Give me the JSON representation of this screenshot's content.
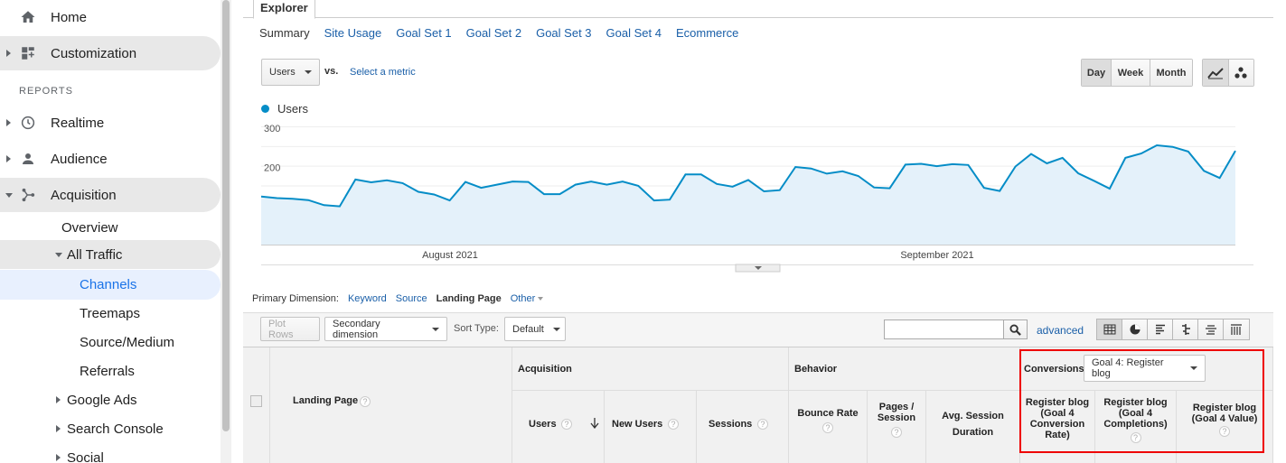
{
  "sidebar": {
    "home": "Home",
    "customization": "Customization",
    "section": "REPORTS",
    "realtime": "Realtime",
    "audience": "Audience",
    "acquisition": "Acquisition",
    "overview": "Overview",
    "all_traffic": "All Traffic",
    "channels": "Channels",
    "treemaps": "Treemaps",
    "source_medium": "Source/Medium",
    "referrals": "Referrals",
    "google_ads": "Google Ads",
    "search_console": "Search Console",
    "social": "Social"
  },
  "explorer": {
    "tab": "Explorer",
    "subtabs": [
      "Summary",
      "Site Usage",
      "Goal Set 1",
      "Goal Set 2",
      "Goal Set 3",
      "Goal Set 4",
      "Ecommerce"
    ]
  },
  "controls": {
    "metric": "Users",
    "vs": "vs.",
    "select_metric": "Select a metric",
    "day": "Day",
    "week": "Week",
    "month": "Month"
  },
  "chart_data": {
    "type": "area",
    "series": [
      {
        "name": "Users",
        "color": "#058dc7",
        "values": [
          122,
          118,
          116,
          113,
          100,
          97,
          165,
          158,
          163,
          156,
          134,
          127,
          112,
          159,
          144,
          152,
          160,
          159,
          128,
          128,
          152,
          160,
          152,
          160,
          149,
          112,
          114,
          178,
          178,
          154,
          147,
          164,
          135,
          138,
          197,
          193,
          180,
          186,
          174,
          145,
          143,
          203,
          205,
          199,
          204,
          202,
          144,
          136,
          198,
          230,
          206,
          220,
          181,
          162,
          142,
          220,
          231,
          252,
          248,
          236,
          187,
          169,
          238
        ],
        "fill": "#e4f1fa"
      }
    ],
    "x_labels": [
      "August 2021",
      "September 2021"
    ],
    "y_ticks": [
      100,
      200,
      300
    ],
    "ylim": [
      0,
      300
    ]
  },
  "table": {
    "primary_dimension_label": "Primary Dimension:",
    "dimensions": [
      "Keyword",
      "Source",
      "Landing Page",
      "Other"
    ],
    "plot_rows": "Plot Rows",
    "secondary_dimension": "Secondary dimension",
    "sort_type_label": "Sort Type:",
    "sort_type": "Default",
    "advanced": "advanced",
    "landing_page": "Landing Page",
    "acquisition": "Acquisition",
    "behavior": "Behavior",
    "conversions": "Conversions",
    "goal_select": "Goal 4: Register blog",
    "users": "Users",
    "new_users": "New Users",
    "sessions": "Sessions",
    "bounce_rate": "Bounce Rate",
    "pages_session": "Pages / Session",
    "avg_session": "Avg. Session Duration",
    "conv_rate": "Register blog (Goal 4 Conversion Rate)",
    "completions": "Register blog (Goal 4 Completions)",
    "value": "Register blog (Goal 4 Value)",
    "help": "?"
  }
}
